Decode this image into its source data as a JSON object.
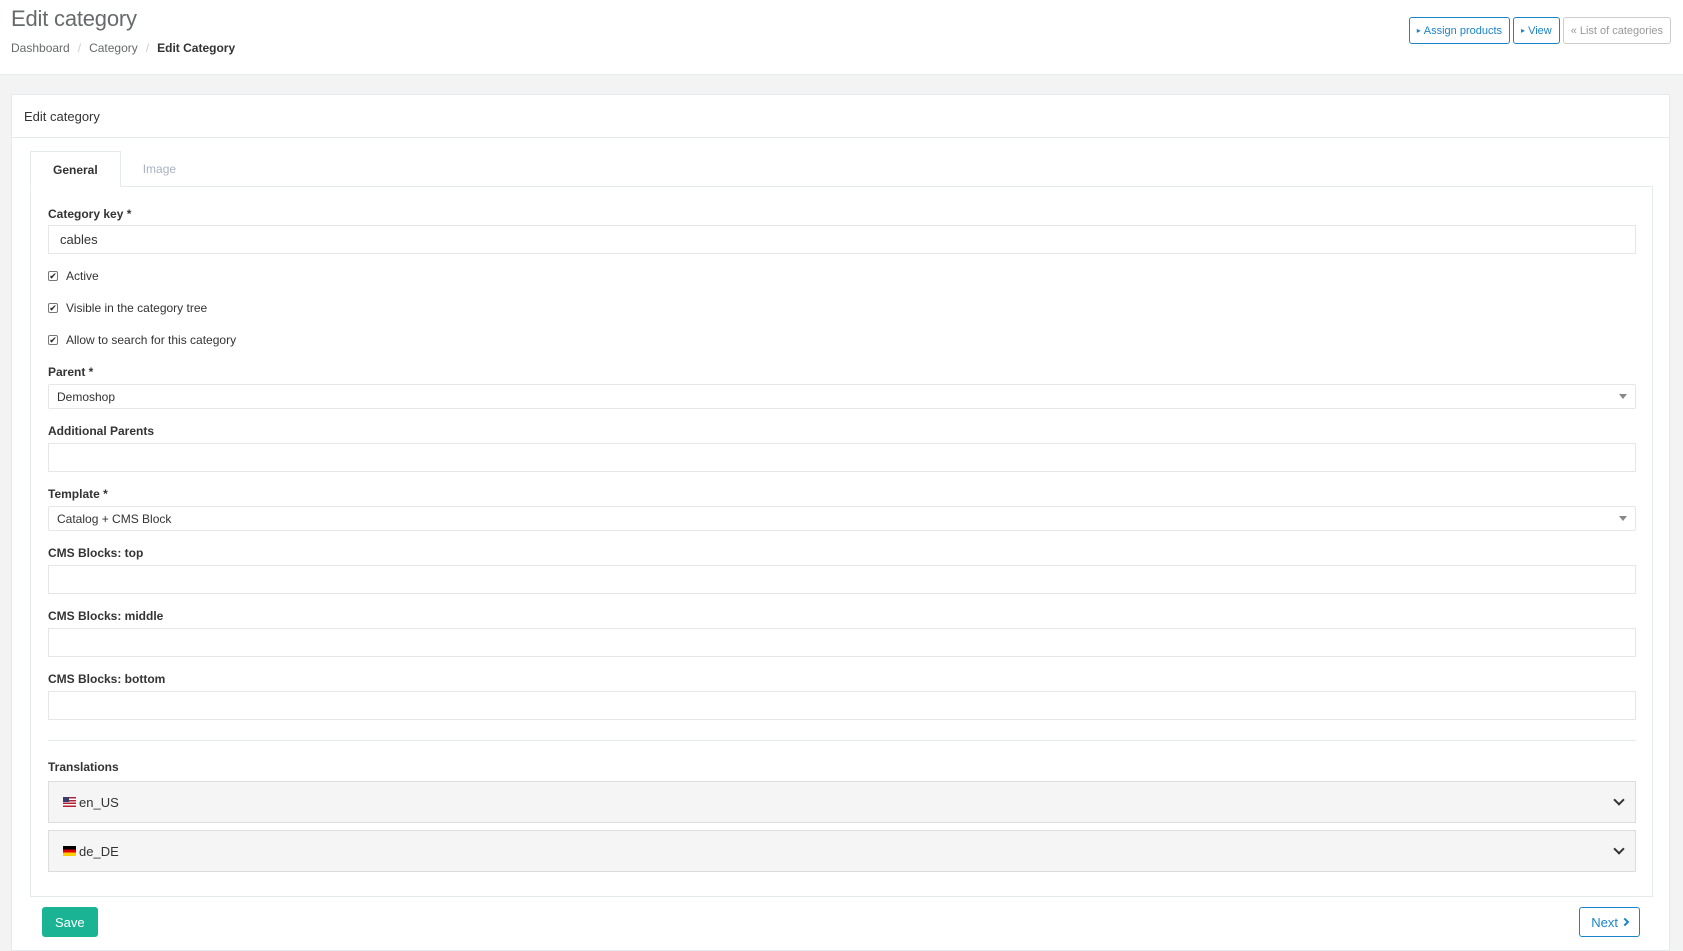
{
  "header": {
    "title": "Edit category",
    "breadcrumb": [
      "Dashboard",
      "Category",
      "Edit Category"
    ],
    "actions": {
      "assign_products": "Assign products",
      "view": "View",
      "list_of_categories": "List of categories"
    }
  },
  "panel": {
    "title": "Edit category",
    "tabs": [
      {
        "label": "General",
        "active": true
      },
      {
        "label": "Image",
        "active": false
      }
    ]
  },
  "form": {
    "category_key": {
      "label": "Category key *",
      "value": "cables"
    },
    "checkboxes": [
      {
        "label": "Active",
        "checked": true
      },
      {
        "label": "Visible in the category tree",
        "checked": true
      },
      {
        "label": "Allow to search for this category",
        "checked": true
      }
    ],
    "parent": {
      "label": "Parent *",
      "value": "Demoshop"
    },
    "additional_parents": {
      "label": "Additional Parents",
      "value": ""
    },
    "template": {
      "label": "Template *",
      "value": "Catalog + CMS Block"
    },
    "cms_top": {
      "label": "CMS Blocks: top",
      "value": ""
    },
    "cms_middle": {
      "label": "CMS Blocks: middle",
      "value": ""
    },
    "cms_bottom": {
      "label": "CMS Blocks: bottom",
      "value": ""
    },
    "translations": {
      "label": "Translations",
      "locales": [
        "en_US",
        "de_DE"
      ]
    }
  },
  "footer": {
    "save": "Save",
    "next": "Next"
  },
  "colors": {
    "primary": "#1ab394",
    "link": "#1c84c6"
  },
  "icons": {
    "checkmark": "✔",
    "double_left": "«",
    "caret_right": "▸"
  }
}
